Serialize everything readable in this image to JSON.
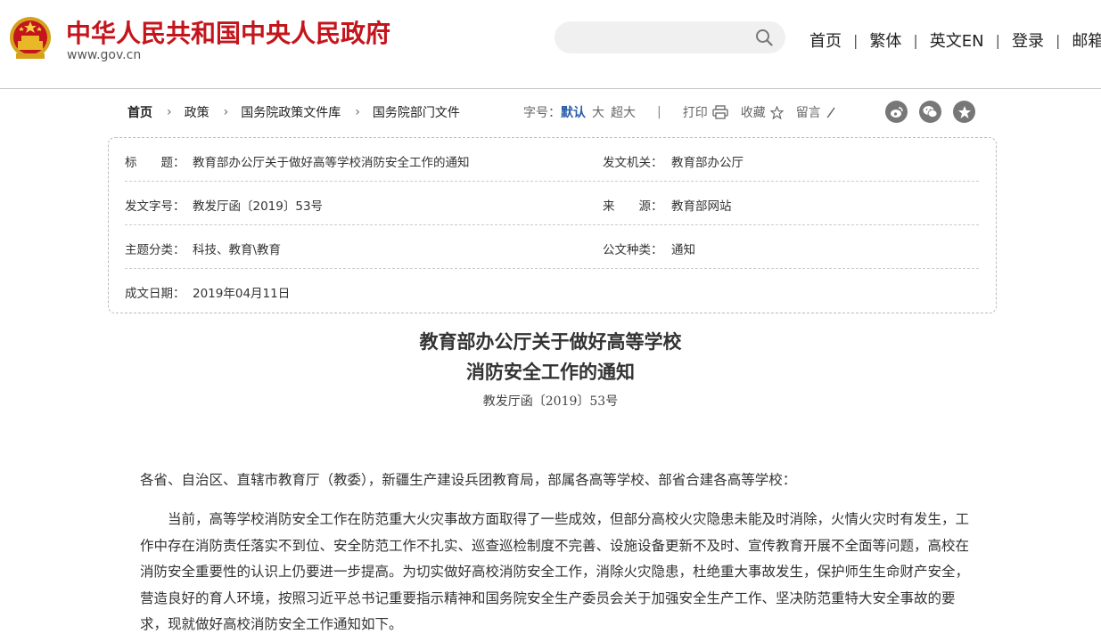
{
  "header": {
    "site_title": "中华人民共和国中央人民政府",
    "site_url": "www.gov.cn",
    "search": {
      "placeholder": "",
      "icon": "search-icon"
    },
    "nav": [
      "首页",
      "繁体",
      "英文EN",
      "登录",
      "邮箱"
    ],
    "brand_color": "#c4151c"
  },
  "breadcrumb": [
    "首页",
    "政策",
    "国务院政策文件库",
    "国务院部门文件"
  ],
  "toolbar": {
    "font_label": "字号：",
    "font_default": "默认",
    "font_large": "大",
    "font_xlarge": "超大",
    "print": "打印",
    "favorite": "收藏",
    "comment": "留言",
    "share_icons": [
      "weibo-icon",
      "wechat-icon",
      "qzone-icon"
    ],
    "accent_color": "#2b5da8"
  },
  "info": {
    "title_label": "标　　题：",
    "title_value": "教育部办公厅关于做好高等学校消防安全工作的通知",
    "issuer_label": "发文机关：",
    "issuer_value": "教育部办公厅",
    "docno_label": "发文字号：",
    "docno_value": "教发厅函〔2019〕53号",
    "source_label": "来　　源：",
    "source_value": "教育部网站",
    "topic_label": "主题分类：",
    "topic_value": "科技、教育\\教育",
    "type_label": "公文种类：",
    "type_value": "通知",
    "date_label": "成文日期：",
    "date_value": "2019年04月11日"
  },
  "document": {
    "title_line1": "教育部办公厅关于做好高等学校",
    "title_line2": "消防安全工作的通知",
    "doc_number": "教发厅函〔2019〕53号",
    "salutation": "各省、自治区、直辖市教育厅（教委），新疆生产建设兵团教育局，部属各高等学校、部省合建各高等学校：",
    "paragraph1": "当前，高等学校消防安全工作在防范重大火灾事故方面取得了一些成效，但部分高校火灾隐患未能及时消除，火情火灾时有发生，工作中存在消防责任落实不到位、安全防范工作不扎实、巡查巡检制度不完善、设施设备更新不及时、宣传教育开展不全面等问题，高校在消防安全重要性的认识上仍要进一步提高。为切实做好高校消防安全工作，消除火灾隐患，杜绝重大事故发生，保护师生生命财产安全，营造良好的育人环境，按照习近平总书记重要指示精神和国务院安全生产委员会关于加强安全生产工作、坚决防范重特大安全事故的要求，现就做好高校消防安全工作通知如下。"
  }
}
